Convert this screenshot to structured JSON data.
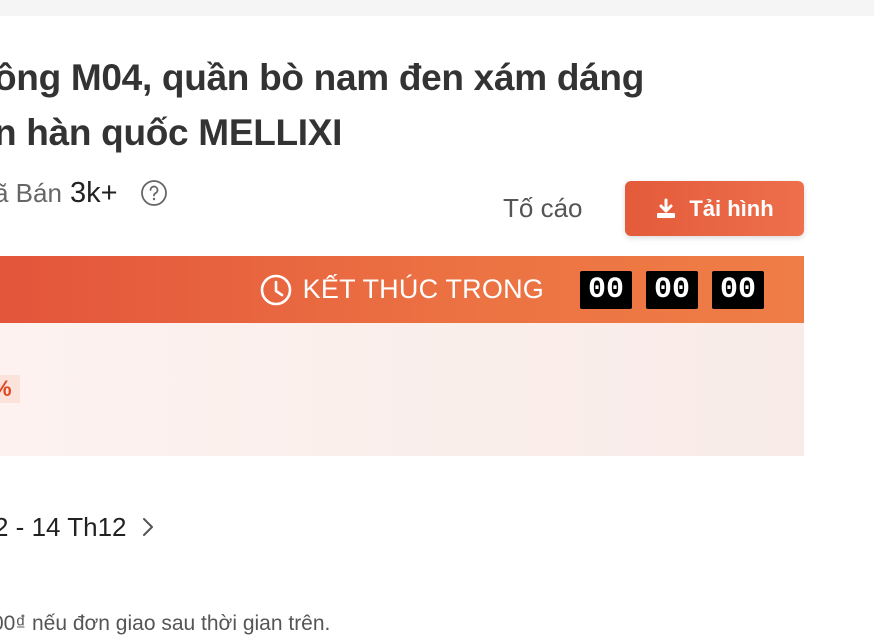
{
  "product": {
    "title_line1": "ông M04, quần bò nam đen xám dáng",
    "title_line2": "n hàn quốc MELLIXI"
  },
  "stats": {
    "sold_label": "ã Bán",
    "sold_value": "3k+",
    "report_label": "Tố cáo"
  },
  "actions": {
    "download_label": "Tải hình"
  },
  "flash_sale": {
    "ends_label": "KẾT THÚC TRONG",
    "hours": "00",
    "minutes": "00",
    "seconds": "00"
  },
  "price": {
    "discount_fragment": "%"
  },
  "shipping": {
    "date_range": "2 - 14 Th12",
    "note": "00₫ nếu đơn giao sau thời gian trên."
  },
  "colors": {
    "accent": "#ee4d2d",
    "flash_bar_start": "#e3553b",
    "flash_bar_end": "#ef7d46"
  },
  "icons": {
    "help": "help-circle-icon",
    "download": "download-icon",
    "clock": "clock-icon",
    "chevron": "chevron-right-icon"
  }
}
